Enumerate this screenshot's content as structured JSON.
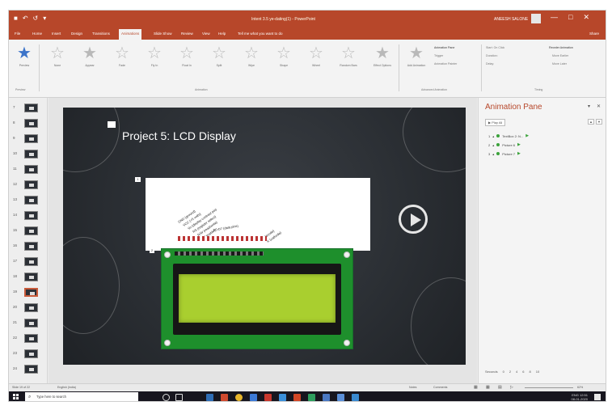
{
  "window": {
    "doc_title": "Intent 3.5 ye-dating(1) - PowerPoint",
    "user_name": "ANEESH SALONE",
    "qat_icons": [
      "save-icon",
      "undo-icon",
      "redo-icon",
      "customize-icon"
    ],
    "controls": [
      "—",
      "□",
      "✕"
    ]
  },
  "menu": {
    "tabs": [
      "File",
      "Home",
      "Insert",
      "Design",
      "Transitions",
      "Animations",
      "Slide Show",
      "Review",
      "View",
      "Help",
      "Tell me what you want to do"
    ],
    "active_tab": "Animations",
    "share": "Share"
  },
  "ribbon": {
    "preview": "Preview",
    "preview_group": "Preview",
    "animation_group": "Animation",
    "animations": [
      "None",
      "Appear",
      "Fade",
      "Fly In",
      "Float In",
      "Split",
      "Wipe",
      "Shape",
      "Wheel",
      "Random Bars"
    ],
    "effect_options": "Effect Options",
    "add_animation": "Add Animation",
    "advanced_group": "Advanced Animation",
    "animation_pane_btn": "Animation Pane",
    "trigger_btn": "Trigger",
    "painter_btn": "Animation Painter",
    "timing_group": "Timing",
    "start_label": "Start: On Click",
    "duration_label": "Duration:",
    "delay_label": "Delay:",
    "reorder_label": "Reorder Animation",
    "move_earlier": "Move Earlier",
    "move_later": "Move Later"
  },
  "thumbnails": [
    "7",
    "8",
    "9",
    "10",
    "11",
    "12",
    "13",
    "14",
    "15",
    "16",
    "17",
    "18",
    "19",
    "20",
    "21",
    "22",
    "23",
    "24"
  ],
  "selected_slide": "19",
  "slide": {
    "title": "Project 5: LCD Display",
    "marker_a": "1",
    "marker_b": "2",
    "pin_labels": [
      "GND (ground)",
      "VCC (+5 volts)",
      "Vo (display contrast pin)",
      "RS (register select)",
      "R/W (read/write)",
      "E (enable)"
    ],
    "data_pins": "D0-D7 (data pins)",
    "backlight": [
      "A (anode)",
      "K (cathode)"
    ]
  },
  "animation_pane": {
    "title": "Animation Pane",
    "play_all": "Play All",
    "items": [
      {
        "num": "1",
        "label": "TextBox 2: N..."
      },
      {
        "num": "2",
        "label": "Picture 6"
      },
      {
        "num": "3",
        "label": "Picture 7"
      }
    ],
    "seconds_label": "Seconds",
    "ticks": [
      "0",
      "2",
      "4",
      "6",
      "8",
      "10"
    ]
  },
  "status": {
    "slide_info": "Slide 19 of 22",
    "language": "English (India)",
    "notes": "Notes",
    "comments": "Comments",
    "zoom": "62%"
  },
  "taskbar": {
    "search_placeholder": "Type here to search",
    "lang": "ENG",
    "time": "12:51",
    "date": "08-01-2020"
  },
  "colors": {
    "accent": "#b7472a",
    "lcd_board": "#1e8f2c",
    "lcd_screen": "#a9cf2f"
  }
}
